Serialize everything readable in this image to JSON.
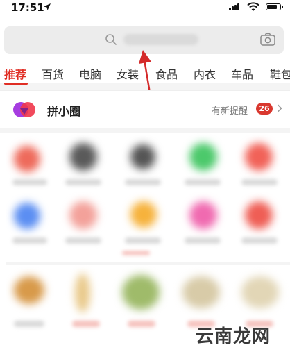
{
  "status_bar": {
    "time": "17:51"
  },
  "search": {
    "placeholder": ""
  },
  "tabs": [
    {
      "label": "推荐",
      "active": true
    },
    {
      "label": "百货",
      "active": false
    },
    {
      "label": "电脑",
      "active": false
    },
    {
      "label": "女装",
      "active": false
    },
    {
      "label": "食品",
      "active": false
    },
    {
      "label": "内衣",
      "active": false
    },
    {
      "label": "车品",
      "active": false
    },
    {
      "label": "鞋包",
      "active": false
    }
  ],
  "circle": {
    "title": "拼小圈",
    "reminder": "有新提醒",
    "badge": "26"
  },
  "colors": {
    "accent": "#e02e24",
    "badge": "#d9382f"
  },
  "watermark": {
    "text": "云南龙网"
  }
}
